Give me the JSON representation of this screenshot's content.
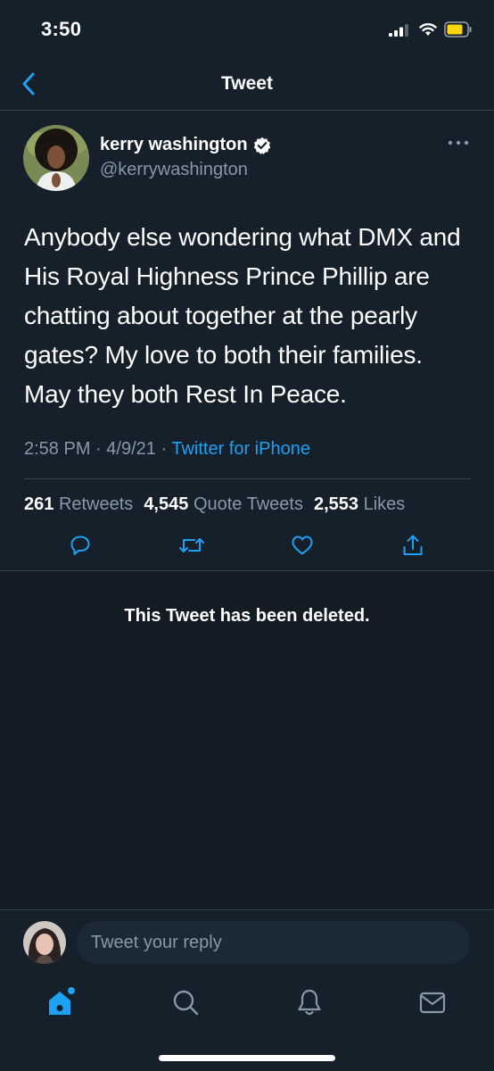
{
  "status_bar": {
    "time": "3:50"
  },
  "nav": {
    "title": "Tweet"
  },
  "tweet": {
    "author_name": "kerry washington",
    "author_handle": "@kerrywashington",
    "text": "Anybody else wondering what DMX and His Royal Highness Prince Phillip are chatting about together at the pearly gates? My love to both their families. May they both Rest In Peace.",
    "time": "2:58 PM",
    "date": "4/9/21",
    "separator": "·",
    "source": "Twitter for iPhone",
    "retweets_count": "261",
    "retweets_label": "Retweets",
    "quotes_count": "4,545",
    "quotes_label": "Quote Tweets",
    "likes_count": "2,553",
    "likes_label": "Likes"
  },
  "deleted": {
    "message": "This Tweet has been deleted."
  },
  "reply": {
    "placeholder": "Tweet your reply"
  },
  "colors": {
    "background": "#15202b",
    "accent": "#1da1f2",
    "secondary_text": "#8899a6",
    "divider": "#38444d"
  },
  "icons": [
    "back-chevron",
    "verified-badge",
    "more-dots",
    "reply",
    "retweet",
    "like",
    "share",
    "home",
    "search",
    "notifications",
    "messages"
  ]
}
